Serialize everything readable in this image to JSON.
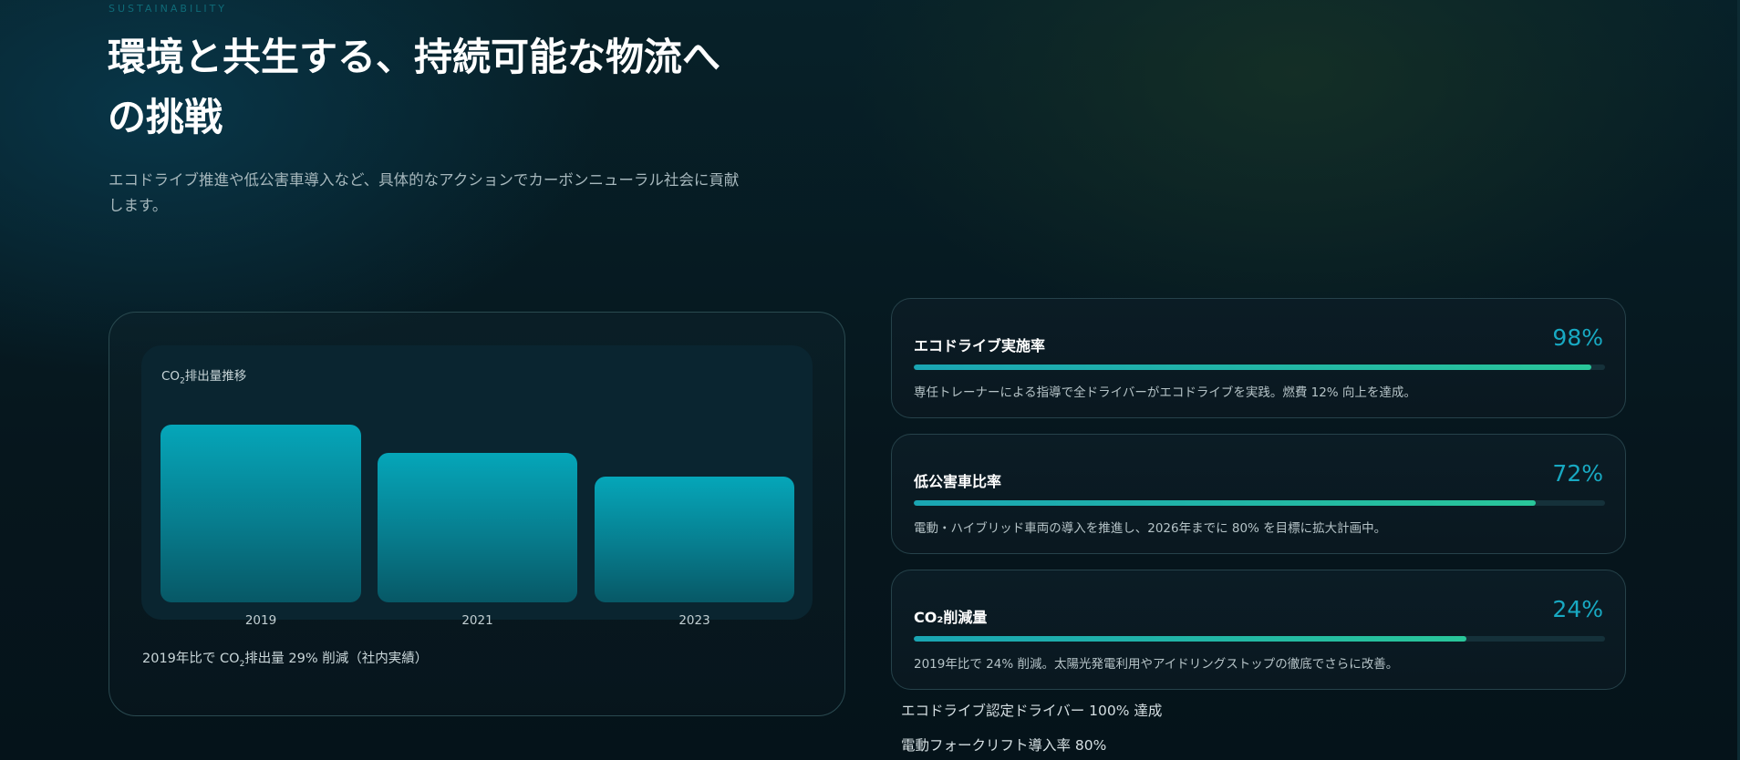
{
  "section": {
    "eyebrow": "SUSTAINABILITY",
    "title": "環境と共生する、持続可能な物流への挑戦",
    "lead": "エコドライブ推進や低公害車導入など、具体的なアクションでカーボンニューラル社会に貢献します。"
  },
  "chart_panel": {
    "title_prefix": "CO",
    "title_sub": "2",
    "title_suffix": "排出量推移",
    "note_prefix": "2019年比で CO",
    "note_sub": "2",
    "note_suffix": "排出量 29% 削減（社内実績）"
  },
  "chart_data": {
    "type": "bar",
    "categories": [
      "2019",
      "2021",
      "2023"
    ],
    "values": [
      100,
      84,
      71
    ],
    "ylim": [
      0,
      100
    ],
    "title": "CO2排出量推移",
    "xlabel": "",
    "ylabel": ""
  },
  "metrics": [
    {
      "name": "エコドライブ実施率",
      "value": "98%",
      "progress": 0.98,
      "desc": "専任トレーナーによる指導で全ドライバーがエコドライブを実践。燃費 12% 向上を達成。"
    },
    {
      "name": "低公害車比率",
      "value": "72%",
      "progress": 0.9,
      "desc": "電動・ハイブリッド車両の導入を推進し、2026年までに 80% を目標に拡大計画中。"
    },
    {
      "name": "CO₂削減量",
      "value": "24%",
      "progress": 0.8,
      "desc": "2019年比で 24% 削減。太陽光発電利用やアイドリングストップの徹底でさらに改善。"
    }
  ],
  "bullets": [
    "エコドライブ認定ドライバー 100% 達成",
    "電動フォークリフト導入率 80%"
  ],
  "colors": {
    "accent": "#18a9c2",
    "progress_start": "#1aa5b3",
    "progress_end": "#29c69a",
    "bar": "#05a6b9"
  }
}
